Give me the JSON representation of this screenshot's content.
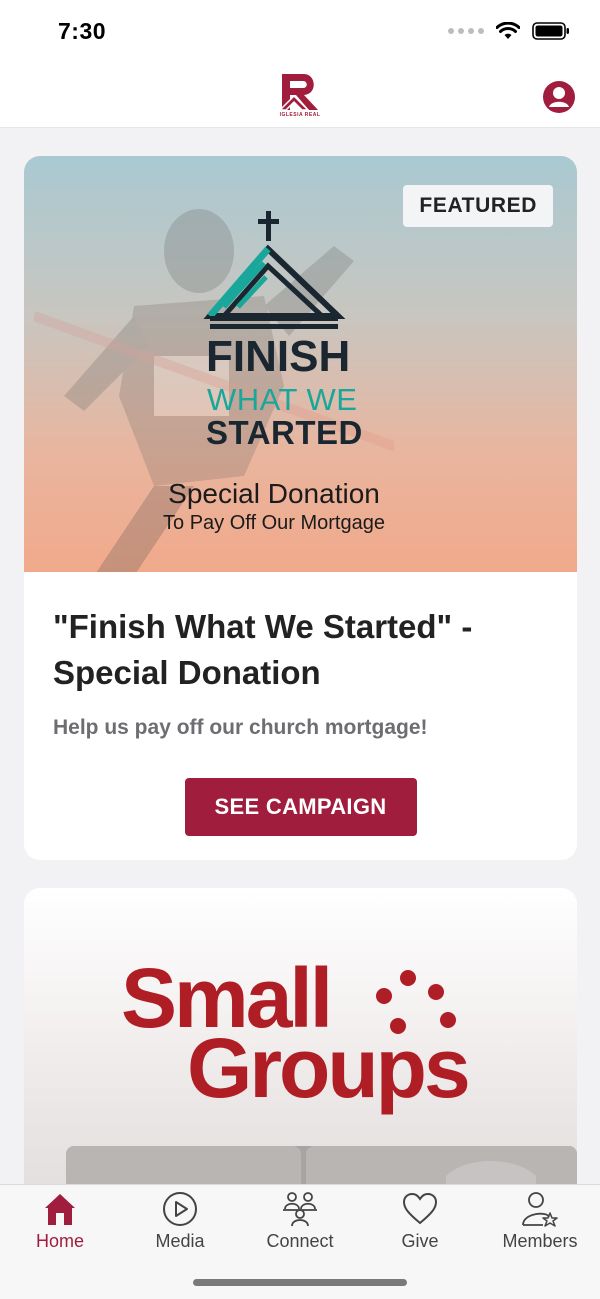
{
  "status_bar": {
    "time": "7:30"
  },
  "header": {
    "logo_text": "IGLESIA REAL",
    "profile_icon": "user-icon"
  },
  "featured_card": {
    "badge": "FEATURED",
    "image_text": {
      "finish": "FINISH",
      "what": "WHAT WE",
      "started": "STARTED",
      "special": "Special Donation",
      "pay": "To Pay Off Our Mortgage"
    },
    "title": "\"Finish What We Started\" - Special Donation",
    "subtitle": "Help us pay off our church mortgage!",
    "cta_label": "SEE CAMPAIGN"
  },
  "groups_card": {
    "line1": "Small",
    "line2": "Groups"
  },
  "tabs": [
    {
      "label": "Home",
      "icon": "home-icon",
      "active": true
    },
    {
      "label": "Media",
      "icon": "play-icon",
      "active": false
    },
    {
      "label": "Connect",
      "icon": "people-icon",
      "active": false
    },
    {
      "label": "Give",
      "icon": "heart-icon",
      "active": false
    },
    {
      "label": "Members",
      "icon": "member-star-icon",
      "active": false
    }
  ],
  "colors": {
    "accent": "#a01d3d",
    "teal": "#19a79b",
    "groups_red": "#b01e25"
  }
}
